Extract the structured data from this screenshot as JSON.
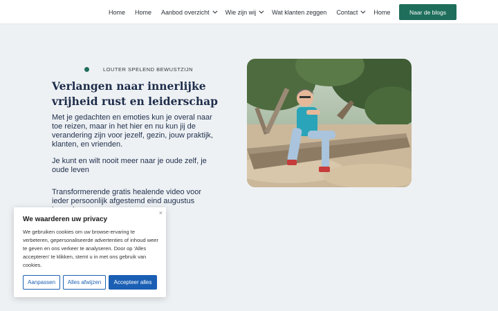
{
  "nav": {
    "items": [
      {
        "label": "Home",
        "dropdown": false
      },
      {
        "label": "Home",
        "dropdown": false
      },
      {
        "label": "Aanbod overzicht",
        "dropdown": true
      },
      {
        "label": "Wie zijn wij",
        "dropdown": true
      },
      {
        "label": "Wat klanten zeggen",
        "dropdown": false
      },
      {
        "label": "Contact",
        "dropdown": true
      },
      {
        "label": "Home",
        "dropdown": false
      }
    ],
    "cta_label": "Naar de blogs"
  },
  "hero": {
    "eyebrow": "LOUTER SPELEND BEWUSTZIJN",
    "title": "Verlangen naar innerlijke vrijheid rust en leiderschap",
    "paragraph1": "Met je gedachten en emoties kun je overal naar toe reizen, maar in het hier en nu kun jij de  verandering zijn voor jezelf, gezin, jouw praktijk, klanten, en vrienden.",
    "paragraph2": "Je kunt en wilt nooit meer naar je oude zelf, je oude leven",
    "paragraph3": " Transformerende gratis healende video voor ieder persoonlijk afgestemd eind augustus lancering"
  },
  "cookie": {
    "title": "We waarderen uw privacy",
    "body": "We gebruiken cookies om uw browse-ervaring te verbeteren, gepersonaliseerde advertenties of inhoud weer te geven en ons verkeer te analyseren. Door op 'Alles accepteren' te klikken, stemt u in met ons gebruik van cookies.",
    "close": "×",
    "customize_label": "Aanpassen",
    "reject_label": "Alles afwijzen",
    "accept_label": "Accepteer alles"
  },
  "colors": {
    "brand_green": "#1e6e5b",
    "heading_navy": "#1d2d4a",
    "cookie_blue": "#1a5fb4",
    "page_bg": "#eef1f4"
  }
}
